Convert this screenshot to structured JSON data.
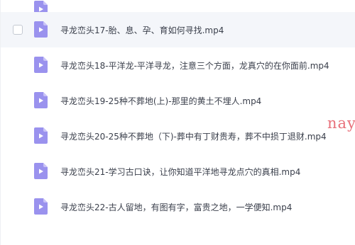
{
  "files": [
    {
      "name": "",
      "icon": "video-file-icon",
      "selected": false
    },
    {
      "name": "寻龙峦头17-胎、息、孕、育如何寻找.mp4",
      "icon": "video-file-icon",
      "selected": false
    },
    {
      "name": "寻龙峦头18-平洋龙-平洋寻龙，注意三个方面，龙真穴的在你面前.mp4",
      "icon": "video-file-icon",
      "selected": false
    },
    {
      "name": "寻龙峦头19-25种不葬地(上)-那里的黄土不埋人.mp4",
      "icon": "video-file-icon",
      "selected": false
    },
    {
      "name": "寻龙峦头20-25种不葬地（下)-葬中有丁财贵寿，葬不中损丁退财.mp4",
      "icon": "video-file-icon",
      "selected": false
    },
    {
      "name": "寻龙峦头21-学习古口诀，让你知道平洋地寻龙点穴的真相.mp4",
      "icon": "video-file-icon",
      "selected": false
    },
    {
      "name": "寻龙峦头22-古人留地，有图有字，富贵之地，一学便知.mp4",
      "icon": "video-file-icon",
      "selected": false
    }
  ],
  "watermark": "nay",
  "colors": {
    "icon_bg": "#9a92ee",
    "icon_fold": "#c9c3f7",
    "hover_bg": "#f4f6fa",
    "text": "#3a3f4b",
    "watermark": "#e8707a"
  }
}
